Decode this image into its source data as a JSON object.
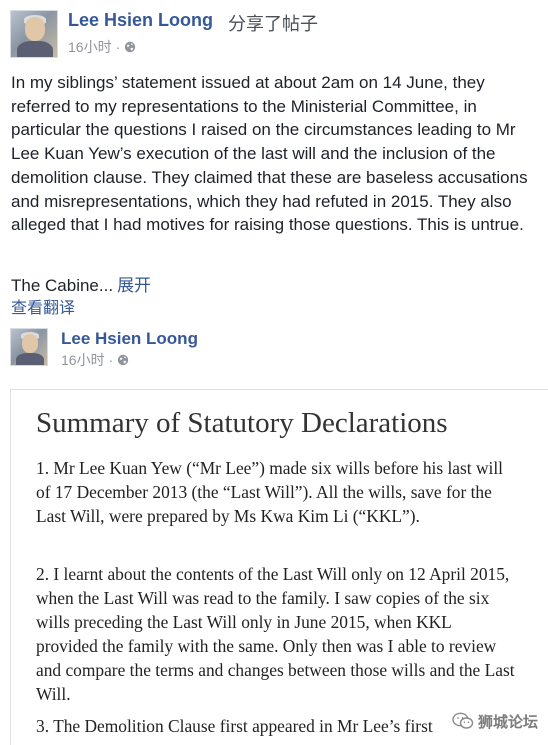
{
  "post": {
    "author": "Lee Hsien Loong",
    "action": "分享了帖子",
    "time": "16小时",
    "separator": "·",
    "privacy_icon": "globe-icon",
    "text": "In my siblings’ statement issued at about 2am on 14 June, they referred to my representations to the Ministerial Committee, in particular the questions I raised on the circumstances leading to Mr Lee Kuan Yew’s execution of the last will and the inclusion of the demolition clause. They claimed that these are baseless accusations and misrepresentations, which they had refuted in 2015. They also alleged that I had motives for raising those questions. This is untrue.",
    "truncated_text": "The Cabine...",
    "expand_label": "展开",
    "translate_label": "查看翻译"
  },
  "shared_post": {
    "author": "Lee Hsien Loong",
    "time": "16小时",
    "separator": "·",
    "privacy_icon": "globe-icon"
  },
  "document": {
    "title": "Summary of Statutory Declarations",
    "paragraphs": [
      "1. Mr Lee Kuan Yew (“Mr Lee”) made six wills before his last will of 17 December 2013 (the “Last Will”). All the wills, save for the Last Will, were prepared by Ms Kwa Kim Li (“KKL”).",
      "2. I learnt about the contents of the Last Will only on 12 April 2015, when the Last Will was read to the family. I saw copies of the six wills preceding the Last Will only in June 2015, when KKL provided the family with the same. Only then was I able to review and compare the terms and changes between those wills and the Last Will.",
      "3. The Demolition Clause first appeared in Mr Lee’s first"
    ]
  },
  "watermark": {
    "text": "狮城论坛",
    "icon": "wechat-icon"
  }
}
